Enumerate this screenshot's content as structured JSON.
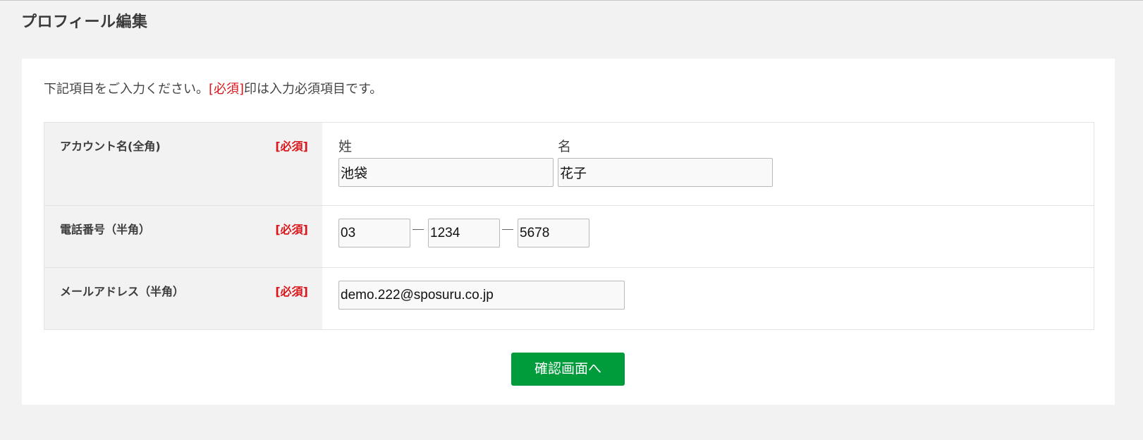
{
  "page": {
    "title": "プロフィール編集"
  },
  "notice": {
    "before": "下記項目をご入力ください。",
    "required": "[必須]",
    "after": "印は入力必須項目です。"
  },
  "form": {
    "account_name": {
      "label": "アカウント名(全角)",
      "required": "[必須]",
      "last_name_label": "姓",
      "last_name_value": "池袋",
      "first_name_label": "名",
      "first_name_value": "花子"
    },
    "phone": {
      "label": "電話番号（半角）",
      "required": "[必須]",
      "part1": "03",
      "part2": "1234",
      "part3": "5678"
    },
    "email": {
      "label": "メールアドレス（半角）",
      "required": "[必須]",
      "value": "demo.222@sposuru.co.jp"
    }
  },
  "actions": {
    "confirm_label": "確認画面へ"
  },
  "colors": {
    "background": "#f2f2f2",
    "required": "#d9161b",
    "button": "#009c3b"
  }
}
